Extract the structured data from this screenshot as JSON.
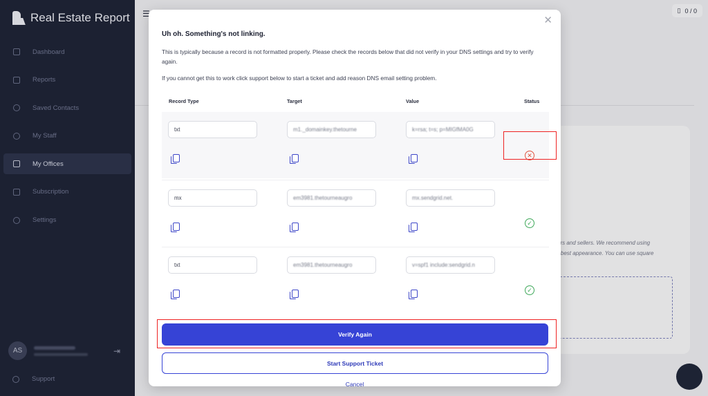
{
  "app": {
    "title": "Real Estate Report"
  },
  "sidebar": {
    "items": [
      {
        "label": "Dashboard"
      },
      {
        "label": "Reports"
      },
      {
        "label": "Saved Contacts"
      },
      {
        "label": "My Staff"
      },
      {
        "label": "My Offices"
      },
      {
        "label": "Subscription"
      },
      {
        "label": "Settings"
      }
    ],
    "active": "My Offices",
    "user_initials": "AS",
    "support_label": "Support"
  },
  "topbar": {
    "counter": "0 / 0"
  },
  "background": {
    "text_line1": "ers and sellers. We recommend using",
    "text_line2": "r best appearance. You can use square"
  },
  "modal": {
    "title": "Uh oh. Something's not linking.",
    "description": "This is typically because a record is not formatted properly. Please check the records below that did not verify in your DNS settings and try to verify again.",
    "description2": "If you cannot get this to work click support below to start a ticket and add reason DNS email setting problem.",
    "columns": {
      "type": "Record Type",
      "target": "Target",
      "value": "Value",
      "status": "Status"
    },
    "records": [
      {
        "type": "txt",
        "target": "m1._domainkey.thetourne",
        "value": "k=rsa; t=s; p=MIGfMA0G",
        "status": "error"
      },
      {
        "type": "mx",
        "target": "em3981.thetourneaugro",
        "value": "mx.sendgrid.net.",
        "status": "ok"
      },
      {
        "type": "txt",
        "target": "em3981.thetourneaugro",
        "value": "v=spf1 include:sendgrid.n",
        "status": "ok"
      }
    ],
    "verify_label": "Verify Again",
    "ticket_label": "Start Support Ticket",
    "cancel_label": "Cancel"
  },
  "colors": {
    "accent": "#3643d6",
    "error": "#e0533f",
    "success": "#3fa85a",
    "sidebar": "#1d2235"
  }
}
